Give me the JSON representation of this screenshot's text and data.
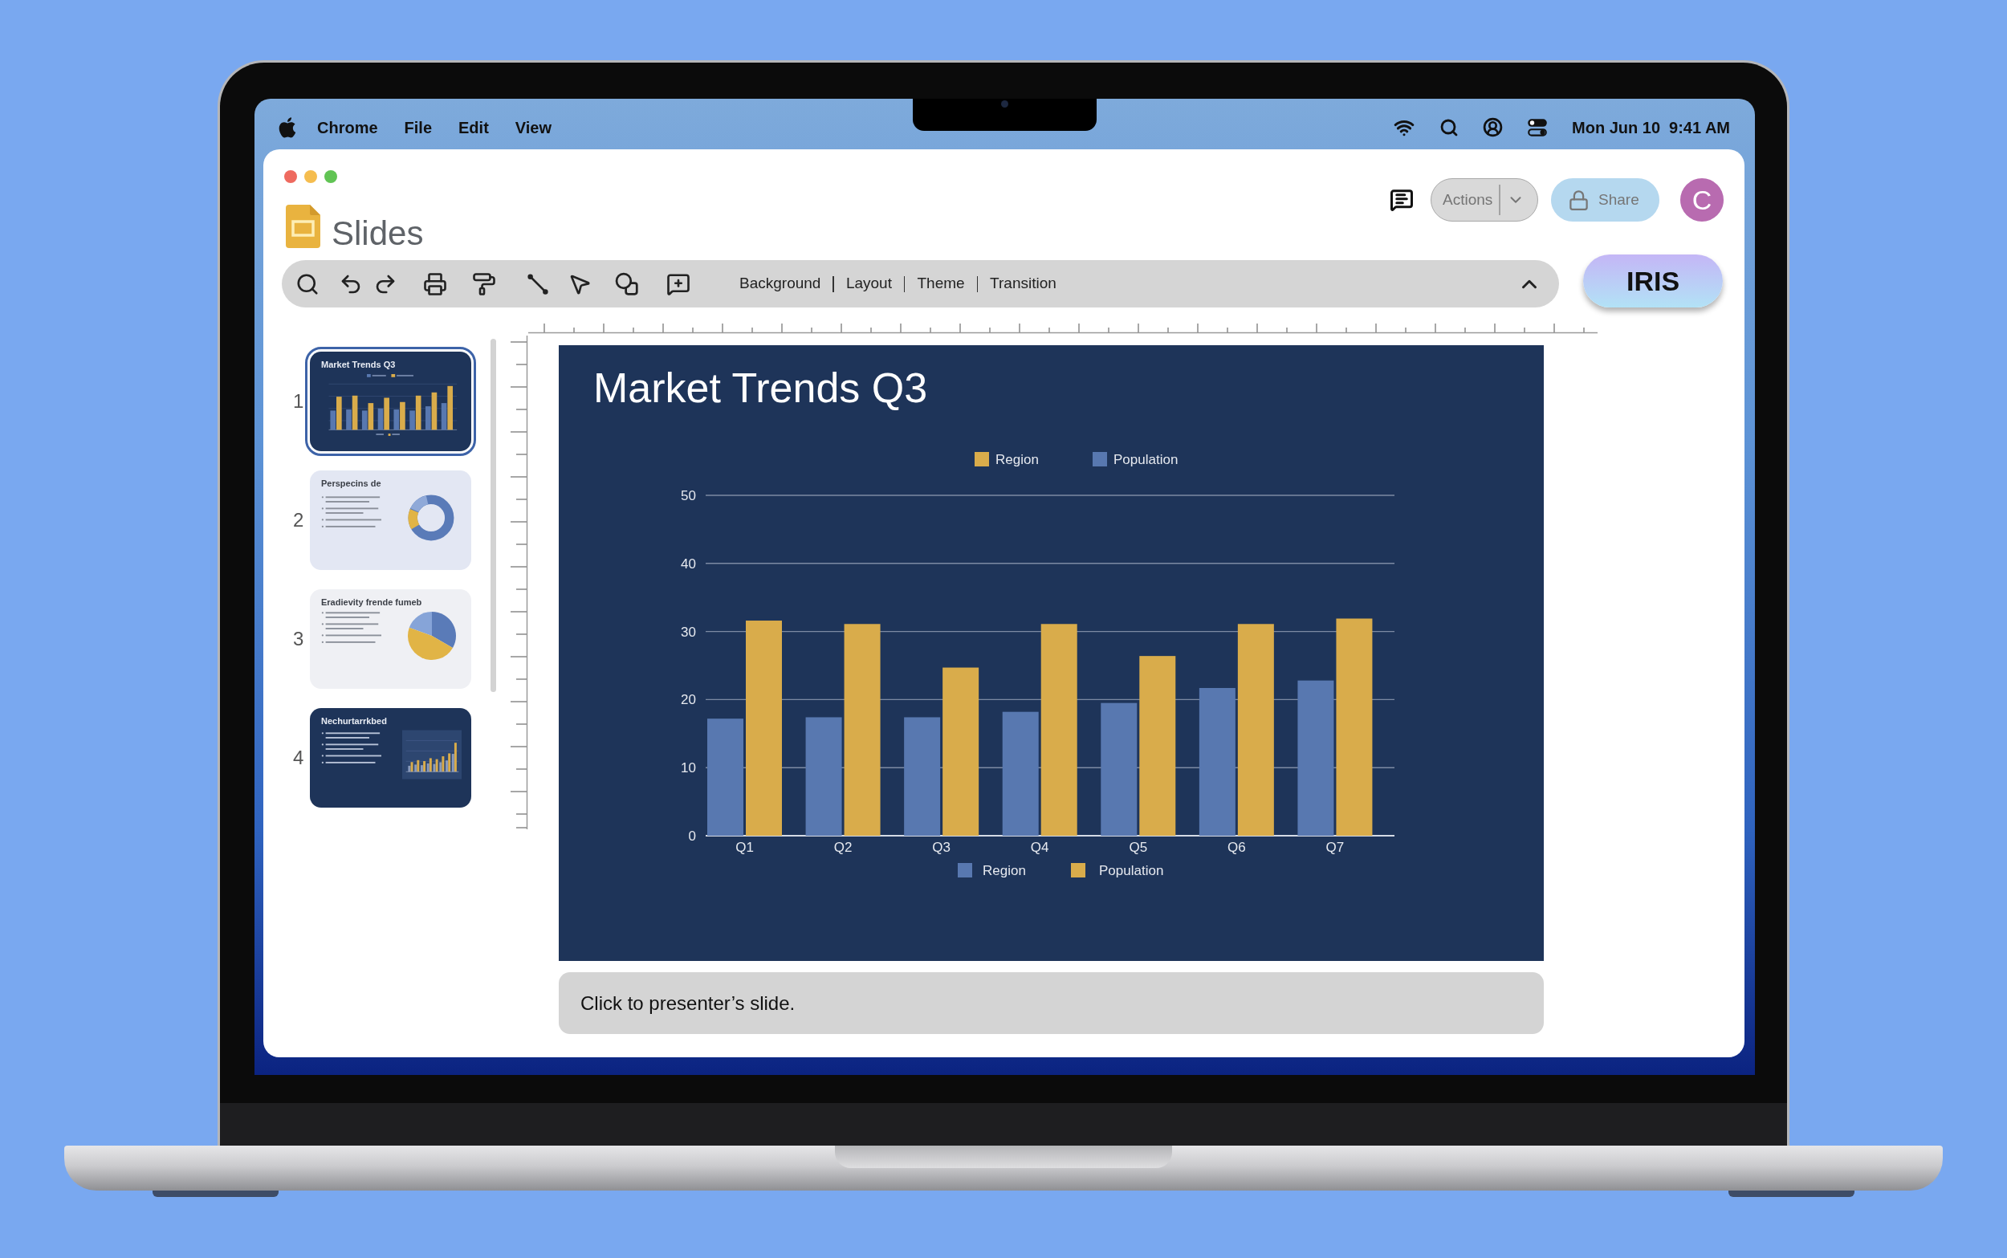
{
  "menu_bar": {
    "app": "Chrome",
    "items": [
      "File",
      "Edit",
      "View"
    ],
    "date": "Mon Jun 10",
    "time": "9:41 AM"
  },
  "window": {
    "app_title": "Slides",
    "actions_button": "Actions",
    "share_button": "Share",
    "avatar_initial": "C",
    "assistant_button": "IRIS"
  },
  "toolbar": {
    "menus": [
      "Background",
      "Layout",
      "Theme",
      "Transition"
    ]
  },
  "slides": [
    {
      "number": "1",
      "title": "Market Trends Q3",
      "kind": "bar-chart",
      "selected": true
    },
    {
      "number": "2",
      "title": "Perspecins de",
      "kind": "donut",
      "selected": false
    },
    {
      "number": "3",
      "title": "Eradievity frende fumeb",
      "kind": "pie",
      "selected": false
    },
    {
      "number": "4",
      "title": "Nechurtarrkbed",
      "kind": "text-chart",
      "selected": false
    }
  ],
  "slide": {
    "title": "Market Trends Q3",
    "top_legend": [
      {
        "label": "Region",
        "color": "#d9ac4b"
      },
      {
        "label": "Population",
        "color": "#5878b0"
      }
    ],
    "chart_data": {
      "type": "bar",
      "categories": [
        "Q1",
        "Q2",
        "Q3",
        "Q4",
        "Q5",
        "Q6",
        "Q7"
      ],
      "series": [
        {
          "name": "Region",
          "color": "#5878b0",
          "values": [
            17.2,
            17.4,
            17.4,
            18.2,
            19.5,
            21.7,
            22.8
          ]
        },
        {
          "name": "Population",
          "color": "#d9ac4b",
          "values": [
            31.6,
            31.1,
            24.7,
            31.1,
            26.4,
            31.1,
            31.9
          ]
        }
      ],
      "ylim": [
        0,
        50
      ],
      "yticks": [
        0,
        10,
        20,
        30,
        40,
        50
      ],
      "grid": true,
      "legend": true
    }
  },
  "notes": {
    "text": "Click to presenter’s slide."
  }
}
